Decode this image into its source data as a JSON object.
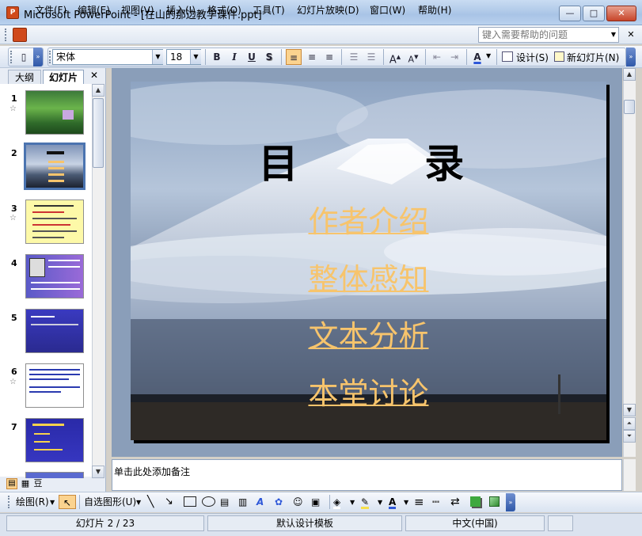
{
  "window": {
    "app_icon_text": "P",
    "title": "Microsoft PowerPoint - [在山的那边教学课件.ppt]",
    "buttons": {
      "minimize": "—",
      "maximize": "□",
      "close": "✕"
    }
  },
  "menu": {
    "items": [
      "文件(F)",
      "编辑(E)",
      "视图(V)",
      "插入(I)",
      "格式(O)",
      "工具(T)",
      "幻灯片放映(D)",
      "窗口(W)",
      "帮助(H)"
    ],
    "help_placeholder": "键入需要帮助的问题"
  },
  "toolbar": {
    "font_name": "宋体",
    "font_size": "18",
    "bold": "B",
    "italic": "I",
    "underline": "U",
    "shadow": "S",
    "design_label": "设计(S)",
    "new_slide_label": "新幻灯片(N)"
  },
  "left_panel": {
    "tabs": [
      "大纲",
      "幻灯片"
    ],
    "close_glyph": "✕",
    "thumbnails": [
      {
        "num": "1",
        "star": "☆"
      },
      {
        "num": "2",
        "star": ""
      },
      {
        "num": "3",
        "star": "☆"
      },
      {
        "num": "4",
        "star": ""
      },
      {
        "num": "5",
        "star": ""
      },
      {
        "num": "6",
        "star": "☆"
      },
      {
        "num": "7",
        "star": ""
      }
    ]
  },
  "slide": {
    "title": "目    录",
    "links": [
      "作者介绍",
      "整体感知",
      "文本分析",
      "本堂讨论"
    ]
  },
  "notes": {
    "placeholder": "单击此处添加备注"
  },
  "drawing": {
    "draw_label": "绘图(R)",
    "autoshapes_label": "自选图形(U)"
  },
  "status": {
    "slide": "幻灯片 2 / 23",
    "template": "默认设计模板",
    "language": "中文(中国)"
  },
  "colors": {
    "link": "#f7c46c",
    "selected_thumb": "#4b74b0",
    "canvas": "#8a9eb9"
  }
}
